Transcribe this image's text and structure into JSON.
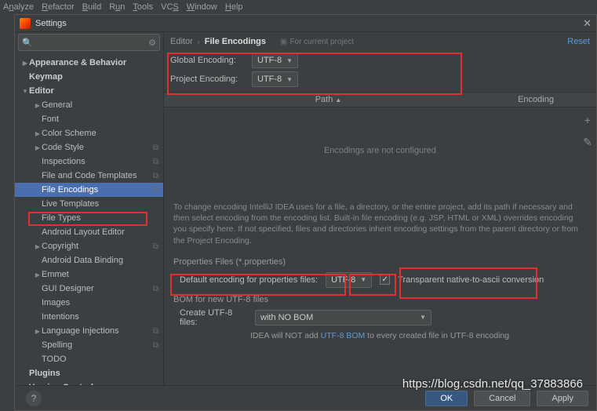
{
  "menubar": [
    "Analyze",
    "Refactor",
    "Build",
    "Run",
    "Tools",
    "VCS",
    "Window",
    "Help"
  ],
  "dialog": {
    "title": "Settings"
  },
  "search": {
    "placeholder": ""
  },
  "sidebar": {
    "items": [
      {
        "label": "Appearance & Behavior",
        "lvl": 0,
        "arrow": "collapsed",
        "bold": true
      },
      {
        "label": "Keymap",
        "lvl": 0,
        "arrow": "none",
        "bold": true
      },
      {
        "label": "Editor",
        "lvl": 0,
        "arrow": "expanded",
        "bold": true
      },
      {
        "label": "General",
        "lvl": 1,
        "arrow": "collapsed"
      },
      {
        "label": "Font",
        "lvl": 1,
        "arrow": "none"
      },
      {
        "label": "Color Scheme",
        "lvl": 1,
        "arrow": "collapsed"
      },
      {
        "label": "Code Style",
        "lvl": 1,
        "arrow": "collapsed",
        "badge": "⧉"
      },
      {
        "label": "Inspections",
        "lvl": 1,
        "arrow": "none",
        "badge": "⧉"
      },
      {
        "label": "File and Code Templates",
        "lvl": 1,
        "arrow": "none",
        "badge": "⧉"
      },
      {
        "label": "File Encodings",
        "lvl": 1,
        "arrow": "none",
        "badge": "⧉",
        "selected": true
      },
      {
        "label": "Live Templates",
        "lvl": 1,
        "arrow": "none"
      },
      {
        "label": "File Types",
        "lvl": 1,
        "arrow": "none"
      },
      {
        "label": "Android Layout Editor",
        "lvl": 1,
        "arrow": "none"
      },
      {
        "label": "Copyright",
        "lvl": 1,
        "arrow": "collapsed",
        "badge": "⧉"
      },
      {
        "label": "Android Data Binding",
        "lvl": 1,
        "arrow": "none"
      },
      {
        "label": "Emmet",
        "lvl": 1,
        "arrow": "collapsed"
      },
      {
        "label": "GUI Designer",
        "lvl": 1,
        "arrow": "none",
        "badge": "⧉"
      },
      {
        "label": "Images",
        "lvl": 1,
        "arrow": "none"
      },
      {
        "label": "Intentions",
        "lvl": 1,
        "arrow": "none"
      },
      {
        "label": "Language Injections",
        "lvl": 1,
        "arrow": "collapsed",
        "badge": "⧉"
      },
      {
        "label": "Spelling",
        "lvl": 1,
        "arrow": "none",
        "badge": "⧉"
      },
      {
        "label": "TODO",
        "lvl": 1,
        "arrow": "none"
      },
      {
        "label": "Plugins",
        "lvl": 0,
        "arrow": "none",
        "bold": true
      },
      {
        "label": "Version Control",
        "lvl": 0,
        "arrow": "collapsed",
        "bold": true
      }
    ]
  },
  "breadcrumb": {
    "a": "Editor",
    "b": "File Encodings",
    "forproj": "For current project",
    "reset": "Reset"
  },
  "global": {
    "label": "Global Encoding:",
    "value": "UTF-8"
  },
  "project": {
    "label": "Project Encoding:",
    "value": "UTF-8"
  },
  "table": {
    "col1": "Path",
    "col2": "Encoding",
    "empty": "Encodings are not configured"
  },
  "helptext": "To change encoding IntelliJ IDEA uses for a file, a directory, or the entire project, add its path if necessary and then select encoding from the encoding list. Built-in file encoding (e.g. JSP, HTML or XML) overrides encoding you specify here. If not specified, files and directories inherit encoding settings from the parent directory or from the Project Encoding.",
  "props": {
    "section": "Properties Files (*.properties)",
    "label": "Default encoding for properties files:",
    "value": "UTF-8",
    "cbLabel": "Transparent native-to-ascii conversion",
    "cbChecked": true
  },
  "bom": {
    "section": "BOM for new UTF-8 files",
    "label": "Create UTF-8 files:",
    "value": "with NO BOM",
    "note1": "IDEA will NOT add ",
    "noteLink": "UTF-8 BOM",
    "note2": " to every created file in UTF-8 encoding"
  },
  "buttons": {
    "ok": "OK",
    "cancel": "Cancel",
    "apply": "Apply"
  },
  "watermark": "https://blog.csdn.net/qq_37883866"
}
